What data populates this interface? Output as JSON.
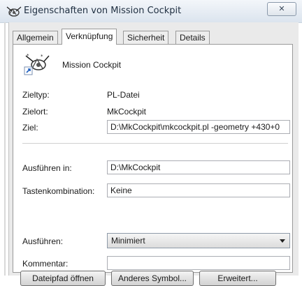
{
  "window": {
    "title": "Eigenschaften von Mission Cockpit",
    "close_glyph": "✕"
  },
  "tabs": [
    {
      "label": "Allgemein",
      "active": false
    },
    {
      "label": "Verknüpfung",
      "active": true
    },
    {
      "label": "Sicherheit",
      "active": false
    },
    {
      "label": "Details",
      "active": false
    }
  ],
  "shortcut": {
    "name": "Mission Cockpit",
    "icon": "satellite-shortcut-icon"
  },
  "info": {
    "type_label": "Zieltyp:",
    "type_value": "PL-Datei",
    "location_label": "Zielort:",
    "location_value": "MkCockpit"
  },
  "fields": {
    "target_label": "Ziel:",
    "target_value": "D:\\MkCockpit\\mkcockpit.pl -geometry +430+0",
    "start_in_label": "Ausführen in:",
    "start_in_value": "D:\\MkCockpit",
    "hotkey_label": "Tastenkombination:",
    "hotkey_value": "Keine",
    "run_label": "Ausführen:",
    "run_value": "Minimiert",
    "comment_label": "Kommentar:",
    "comment_value": ""
  },
  "buttons": {
    "open_path": "Dateipfad öffnen",
    "change_icon": "Anderes Symbol...",
    "advanced": "Erweitert..."
  }
}
